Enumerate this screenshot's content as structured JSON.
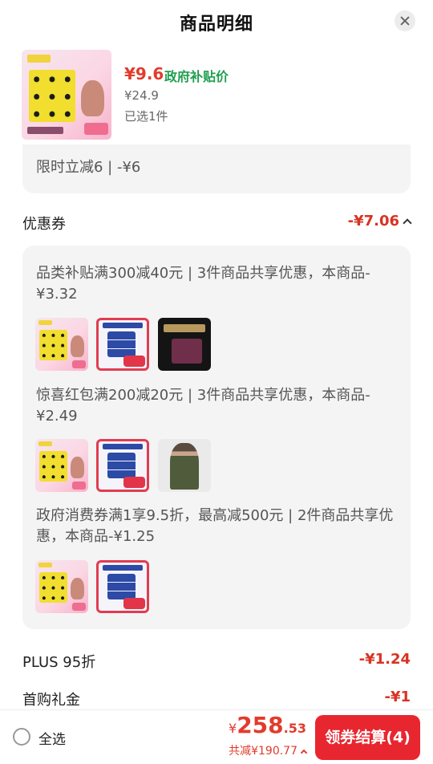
{
  "header": {
    "title": "商品明细"
  },
  "product": {
    "price": "¥9.6",
    "gov_label": "政府补贴价",
    "original_price": "¥24.9",
    "selected": "已选1件"
  },
  "details": {
    "time_limited": "限时立减6 | -¥6",
    "coupon_section": {
      "label": "优惠券",
      "value": "-¥7.06"
    },
    "coupons": [
      {
        "text": "品类补贴满300减40元 | 3件商品共享优惠，本商品-¥3.32",
        "thumbs": [
          "pad-product-icon",
          "pad-box-icon",
          "tea-gift-icon"
        ]
      },
      {
        "text": "惊喜红包满200减20元 | 3件商品共享优惠，本商品-¥2.49",
        "thumbs": [
          "pad-product-icon",
          "pad-box-icon",
          "clothing-photo-icon"
        ]
      },
      {
        "text": "政府消费券满1享9.5折，最高减500元 | 2件商品共享优惠，本商品-¥1.25",
        "thumbs": [
          "pad-product-icon",
          "pad-box-icon"
        ]
      }
    ],
    "plus": {
      "label": "PLUS 95折",
      "value": "-¥1.24"
    },
    "first_gift": {
      "label": "首购礼金",
      "value": "-¥1"
    }
  },
  "footer": {
    "select_all": "全选",
    "currency": "¥",
    "total_main": "258",
    "total_decimal": ".53",
    "saved": "共减¥190.77",
    "checkout": "领券结算(4)"
  },
  "colors": {
    "accent": "#e8262f",
    "price_red": "#e23b2c",
    "gov_green": "#1f9e4f"
  }
}
